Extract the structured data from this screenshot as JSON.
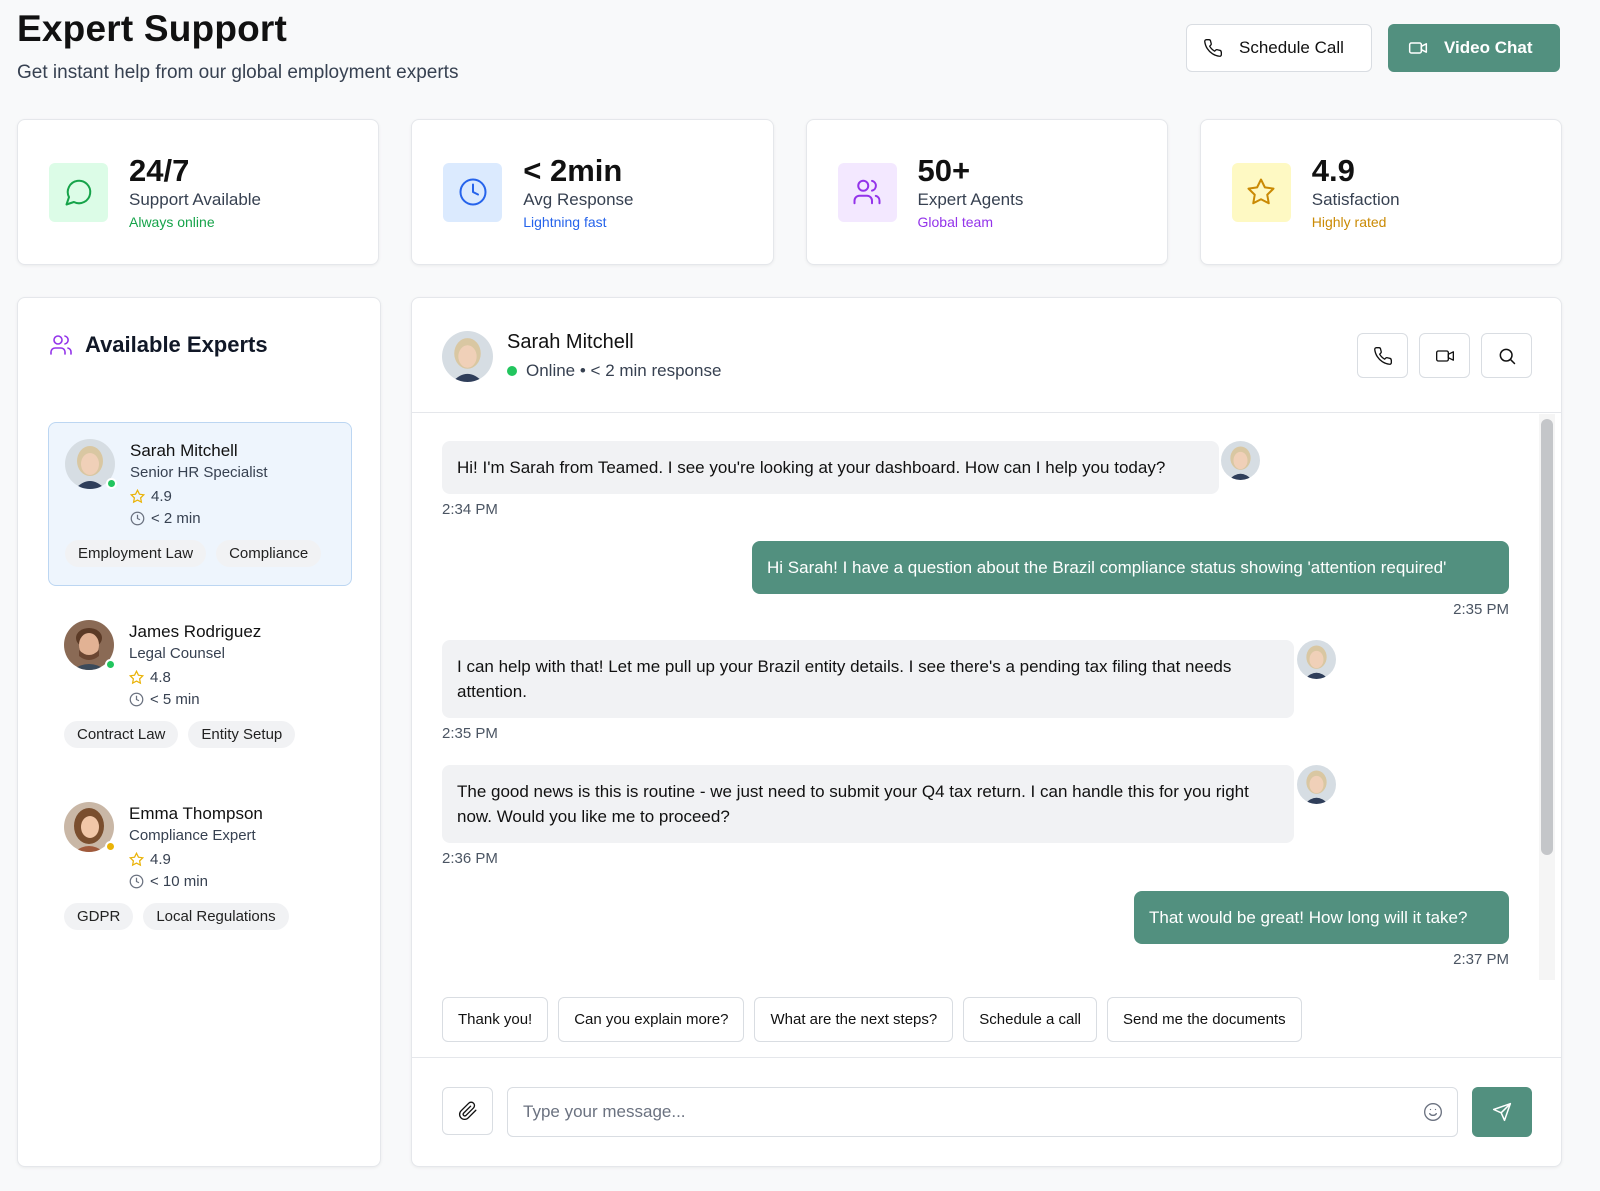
{
  "header": {
    "title": "Expert Support",
    "subtitle": "Get instant help from our global employment experts",
    "schedule_call_label": "Schedule Call",
    "video_chat_label": "Video Chat"
  },
  "stats": [
    {
      "value": "24/7",
      "label": "Support Available",
      "note": "Always online",
      "icon": "chat-bubble-icon",
      "color": "#16a34a",
      "bg": "#dcfce7"
    },
    {
      "value": "< 2min",
      "label": "Avg Response",
      "note": "Lightning fast",
      "icon": "clock-icon",
      "color": "#2563eb",
      "bg": "#dbeafe"
    },
    {
      "value": "50+",
      "label": "Expert Agents",
      "note": "Global team",
      "icon": "users-icon",
      "color": "#9333ea",
      "bg": "#f3e8ff"
    },
    {
      "value": "4.9",
      "label": "Satisfaction",
      "note": "Highly rated",
      "icon": "star-icon",
      "color": "#ca8a04",
      "bg": "#fef9c3"
    }
  ],
  "experts": {
    "title": "Available Experts",
    "items": [
      {
        "name": "Sarah Mitchell",
        "role": "Senior HR Specialist",
        "rating": "4.9",
        "response": "< 2 min",
        "tags": [
          "Employment Law",
          "Compliance"
        ],
        "status_color": "#22c55e"
      },
      {
        "name": "James Rodriguez",
        "role": "Legal Counsel",
        "rating": "4.8",
        "response": "< 5 min",
        "tags": [
          "Contract Law",
          "Entity Setup"
        ],
        "status_color": "#22c55e"
      },
      {
        "name": "Emma Thompson",
        "role": "Compliance Expert",
        "rating": "4.9",
        "response": "< 10 min",
        "tags": [
          "GDPR",
          "Local Regulations"
        ],
        "status_color": "#eab308"
      }
    ]
  },
  "chat": {
    "name": "Sarah Mitchell",
    "status": "Online • < 2 min response",
    "messages": [
      {
        "from": "expert",
        "text": "Hi! I'm Sarah from Teamed. I see you're looking at your dashboard. How can I help you today?",
        "time": "2:34 PM"
      },
      {
        "from": "user",
        "text": "Hi Sarah! I have a question about the Brazil compliance status showing 'attention required'",
        "time": "2:35 PM"
      },
      {
        "from": "expert",
        "text": "I can help with that! Let me pull up your Brazil entity details. I see there's a pending tax filing that needs attention.",
        "time": "2:35 PM"
      },
      {
        "from": "expert",
        "text": "The good news is this is routine - we just need to submit your Q4 tax return. I can handle this for you right now. Would you like me to proceed?",
        "time": "2:36 PM"
      },
      {
        "from": "user",
        "text": "That would be great! How long will it take?",
        "time": "2:37 PM"
      }
    ],
    "quick_replies": [
      "Thank you!",
      "Can you explain more?",
      "What are the next steps?",
      "Schedule a call",
      "Send me the documents"
    ],
    "input_placeholder": "Type your message..."
  },
  "colors": {
    "brand": "#52907f",
    "online": "#22c55e",
    "away": "#eab308"
  }
}
